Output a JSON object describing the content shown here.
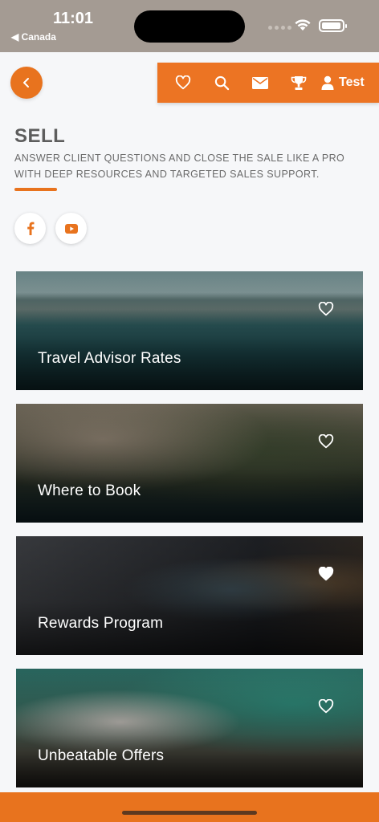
{
  "status_bar": {
    "time": "11:01",
    "back_label": "◀ Canada"
  },
  "header": {
    "back_icon": "chevron-left-icon",
    "nav": [
      {
        "icon": "heart-icon"
      },
      {
        "icon": "search-icon"
      },
      {
        "icon": "mail-icon"
      },
      {
        "icon": "trophy-icon"
      }
    ],
    "user_label": "Test"
  },
  "hero": {
    "title": "SELL",
    "subtitle": "ANSWER CLIENT QUESTIONS AND CLOSE THE SALE LIKE A PRO WITH DEEP RESOURCES AND TARGETED SALES SUPPORT."
  },
  "social": [
    {
      "icon": "facebook-icon"
    },
    {
      "icon": "youtube-icon"
    }
  ],
  "cards": [
    {
      "title": "Travel Advisor Rates",
      "favorited": false
    },
    {
      "title": "Where to Book",
      "favorited": false
    },
    {
      "title": "Rewards Program",
      "favorited": true
    },
    {
      "title": "Unbeatable Offers",
      "favorited": false
    }
  ],
  "colors": {
    "accent": "#e8731e",
    "status_bar": "#a49b93",
    "background": "#f6f7f9",
    "title_text": "#5d5d5d"
  }
}
